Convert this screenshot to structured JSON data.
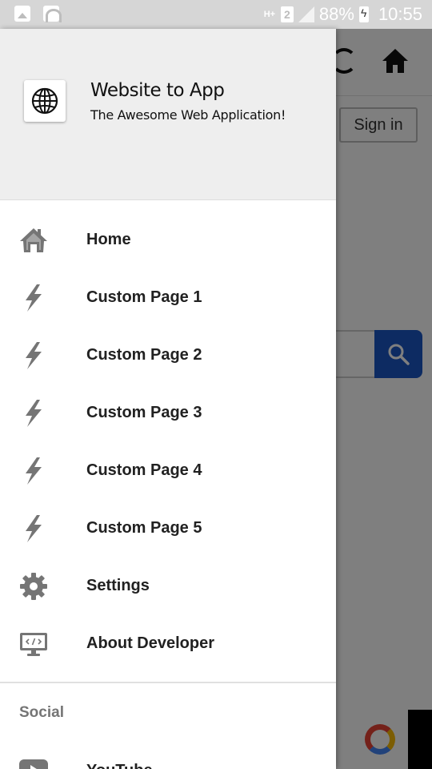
{
  "status_bar": {
    "network": "H+",
    "sim_slot": "2",
    "battery_percent": "88%",
    "time": "10:55"
  },
  "background": {
    "signin_label": "Sign in"
  },
  "drawer": {
    "app_name": "Website to App",
    "app_tagline": "The Awesome Web Application!",
    "items": [
      {
        "label": "Home",
        "icon": "home-icon"
      },
      {
        "label": "Custom Page 1",
        "icon": "bolt-icon"
      },
      {
        "label": "Custom Page 2",
        "icon": "bolt-icon"
      },
      {
        "label": "Custom Page 3",
        "icon": "bolt-icon"
      },
      {
        "label": "Custom Page 4",
        "icon": "bolt-icon"
      },
      {
        "label": "Custom Page 5",
        "icon": "bolt-icon"
      },
      {
        "label": "Settings",
        "icon": "gear-icon"
      },
      {
        "label": "About Developer",
        "icon": "monitor-code-icon"
      }
    ],
    "section_title": "Social",
    "social_items": [
      {
        "label": "YouTube",
        "icon": "youtube-icon"
      }
    ]
  },
  "colors": {
    "accent_search": "#1a56c4",
    "icon_gray": "#757575"
  }
}
